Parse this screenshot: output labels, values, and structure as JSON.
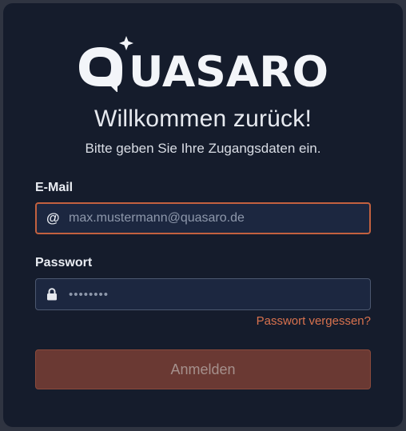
{
  "brand": {
    "name": "QUASARO",
    "logo_rest": "UASARO"
  },
  "header": {
    "title": "Willkommen zurück!",
    "subtitle": "Bitte geben Sie Ihre Zugangsdaten ein."
  },
  "form": {
    "email": {
      "label": "E-Mail",
      "placeholder": "max.mustermann@quasaro.de",
      "value": "",
      "icon": "at-icon",
      "icon_glyph": "@"
    },
    "password": {
      "label": "Passwort",
      "placeholder": "••••••••",
      "value": "",
      "icon": "lock-icon"
    },
    "forgot_link": "Passwort vergessen?",
    "submit_label": "Anmelden"
  },
  "colors": {
    "background": "#151c2c",
    "accent": "#c3613f",
    "link": "#d8724e",
    "button": "#6a3933"
  }
}
